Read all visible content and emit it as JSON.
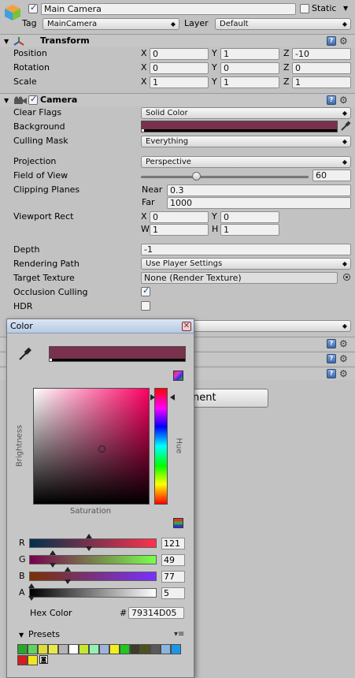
{
  "object": {
    "name": "Main Camera",
    "active": true,
    "static_label": "Static",
    "tag_label": "Tag",
    "tag_value": "MainCamera",
    "layer_label": "Layer",
    "layer_value": "Default"
  },
  "transform": {
    "title": "Transform",
    "position": {
      "label": "Position",
      "x": "0",
      "y": "1",
      "z": "-10"
    },
    "rotation": {
      "label": "Rotation",
      "x": "0",
      "y": "0",
      "z": "0"
    },
    "scale": {
      "label": "Scale",
      "x": "1",
      "y": "1",
      "z": "1"
    }
  },
  "axes": {
    "x": "X",
    "y": "Y",
    "z": "Z",
    "w": "W",
    "h": "H"
  },
  "camera": {
    "title": "Camera",
    "enabled": true,
    "clear_flags": {
      "label": "Clear Flags",
      "value": "Solid Color"
    },
    "background": {
      "label": "Background",
      "color": "#79314D"
    },
    "culling_mask": {
      "label": "Culling Mask",
      "value": "Everything"
    },
    "projection": {
      "label": "Projection",
      "value": "Perspective"
    },
    "fov": {
      "label": "Field of View",
      "value": "60",
      "slider_fraction": 0.33
    },
    "clipping": {
      "label": "Clipping Planes",
      "near_label": "Near",
      "near": "0.3",
      "far_label": "Far",
      "far": "1000"
    },
    "viewport": {
      "label": "Viewport Rect",
      "x": "0",
      "y": "0",
      "w": "1",
      "h": "1"
    },
    "depth": {
      "label": "Depth",
      "value": "-1"
    },
    "rendering_path": {
      "label": "Rendering Path",
      "value": "Use Player Settings"
    },
    "target_texture": {
      "label": "Target Texture",
      "value": "None (Render Texture)"
    },
    "occlusion": {
      "label": "Occlusion Culling",
      "checked": true
    },
    "hdr": {
      "label": "HDR",
      "checked": false
    }
  },
  "add_component_partial": "nent",
  "color_picker": {
    "title": "Color",
    "current_color": "#79314D",
    "brightness_label": "Brightness",
    "saturation_label": "Saturation",
    "hue_label": "Hue",
    "r": {
      "label": "R",
      "value": "121"
    },
    "g": {
      "label": "G",
      "value": "49"
    },
    "b": {
      "label": "B",
      "value": "77"
    },
    "a": {
      "label": "A",
      "value": "5"
    },
    "hex_label": "Hex Color",
    "hash": "#",
    "hex_value": "79314D05",
    "presets_label": "Presets",
    "presets": [
      "#2da52d",
      "#5fd35f",
      "#dcdc3c",
      "#e8e84a",
      "#b4b4b4",
      "#ffffff",
      "#c8e832",
      "#96f0b4",
      "#9eb4dc",
      "#f0f01e",
      "#1ec81e",
      "#3c3c28",
      "#50501e",
      "#5a5a5a",
      "#8cb4dc",
      "#1e96e6",
      "#d21e1e",
      "#f0e61e"
    ]
  },
  "icons": {
    "help": "help-icon",
    "gear": "gear-icon",
    "picker": "eyedropper-icon"
  }
}
